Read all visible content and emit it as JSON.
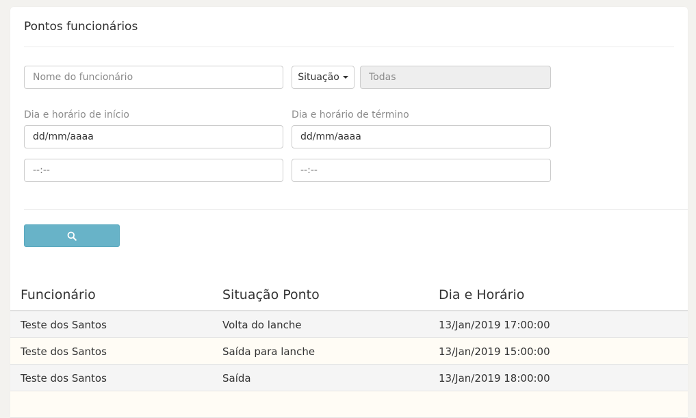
{
  "card": {
    "title": "Pontos funcionários"
  },
  "filters": {
    "employee_name_placeholder": "Nome do funcionário",
    "status_label": "Situação",
    "status_value": "Todas",
    "start_label": "Dia e horário de início",
    "end_label": "Dia e horário de término",
    "start_date_value": "dd/mm/aaaa",
    "start_time_value": "--:--",
    "end_date_value": "dd/mm/aaaa",
    "end_time_value": "--:--"
  },
  "search_button": {
    "icon": "search-icon",
    "color": "#68b3c8"
  },
  "table": {
    "headers": [
      "Funcionário",
      "Situação Ponto",
      "Dia e Horário"
    ],
    "rows": [
      [
        "Teste dos Santos",
        "Volta do lanche",
        "13/Jan/2019 17:00:00"
      ],
      [
        "Teste dos Santos",
        "Saída para lanche",
        "13/Jan/2019 15:00:00"
      ],
      [
        "Teste dos Santos",
        "Saída",
        "13/Jan/2019 18:00:00"
      ]
    ]
  }
}
